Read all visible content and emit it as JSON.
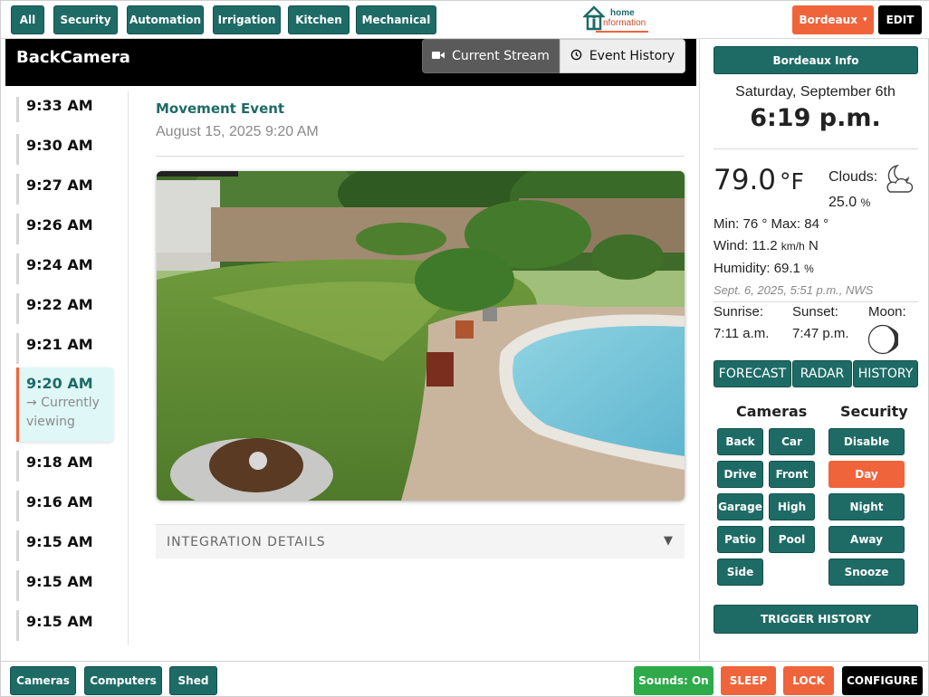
{
  "top_nav": {
    "items": [
      "All",
      "Security",
      "Automation",
      "Irrigation",
      "Kitchen",
      "Mechanical"
    ],
    "logo": {
      "line1": "home",
      "line2": "nformation"
    },
    "location_dropdown": "Bordeaux",
    "location_caret": "▾",
    "edit_label": "EDIT"
  },
  "camera": {
    "title": "BackCamera",
    "tabs": {
      "stream": "Current Stream",
      "history": "Event History"
    }
  },
  "timeline": {
    "items": [
      {
        "time": "9:33 AM"
      },
      {
        "time": "9:30 AM"
      },
      {
        "time": "9:27 AM"
      },
      {
        "time": "9:26 AM"
      },
      {
        "time": "9:24 AM"
      },
      {
        "time": "9:22 AM"
      },
      {
        "time": "9:21 AM"
      },
      {
        "time": "9:20 AM",
        "note_line1": "→ Currently",
        "note_line2": "viewing"
      },
      {
        "time": "9:18 AM"
      },
      {
        "time": "9:16 AM"
      },
      {
        "time": "9:15 AM"
      },
      {
        "time": "9:15 AM"
      },
      {
        "time": "9:15 AM"
      }
    ]
  },
  "event": {
    "title": "Movement Event",
    "datetime": "August 15, 2025 9:20 AM",
    "integration_label": "INTEGRATION DETAILS",
    "integration_caret": "▼"
  },
  "info_panel": {
    "header_button": "Bordeaux Info",
    "date": "Saturday, September 6th",
    "clock": "6:19 p.m.",
    "temperature": "79.0",
    "temperature_unit": "°F",
    "clouds_label": "Clouds:",
    "clouds_value": "25.0",
    "clouds_unit": "%",
    "min_label": "Min:",
    "min_value": "76 °",
    "max_label": "Max:",
    "max_value": "84 °",
    "wind_label": "Wind:",
    "wind_value": "11.2",
    "wind_unit": "km/h",
    "wind_dir": "N",
    "humidity_label": "Humidity:",
    "humidity_value": "69.1",
    "humidity_unit": "%",
    "updated": "Sept. 6, 2025, 5:51 p.m., NWS",
    "sunrise_label": "Sunrise:",
    "sunrise_value": "7:11 a.m.",
    "sunset_label": "Sunset:",
    "sunset_value": "7:47 p.m.",
    "moon_label": "Moon:",
    "buttons": {
      "forecast": "FORECAST",
      "radar": "RADAR",
      "history": "HISTORY"
    },
    "cameras_heading": "Cameras",
    "security_heading": "Security",
    "cameras": [
      "Back",
      "Car",
      "Drive",
      "Front",
      "Garage",
      "High",
      "Patio",
      "Pool",
      "Side"
    ],
    "security": [
      "Disable",
      "Day",
      "Night",
      "Away",
      "Snooze"
    ],
    "security_active": "Day",
    "trigger_history": "TRIGGER HISTORY"
  },
  "bottom_bar": {
    "left": [
      "Cameras",
      "Computers",
      "Shed"
    ],
    "sounds": "Sounds: On",
    "sleep": "SLEEP",
    "lock": "LOCK",
    "configure": "CONFIGURE"
  },
  "colors": {
    "teal": "#1e6b66",
    "orange": "#f0643c",
    "green": "#2eaa4a",
    "active_row_bg": "#dff7f7"
  }
}
